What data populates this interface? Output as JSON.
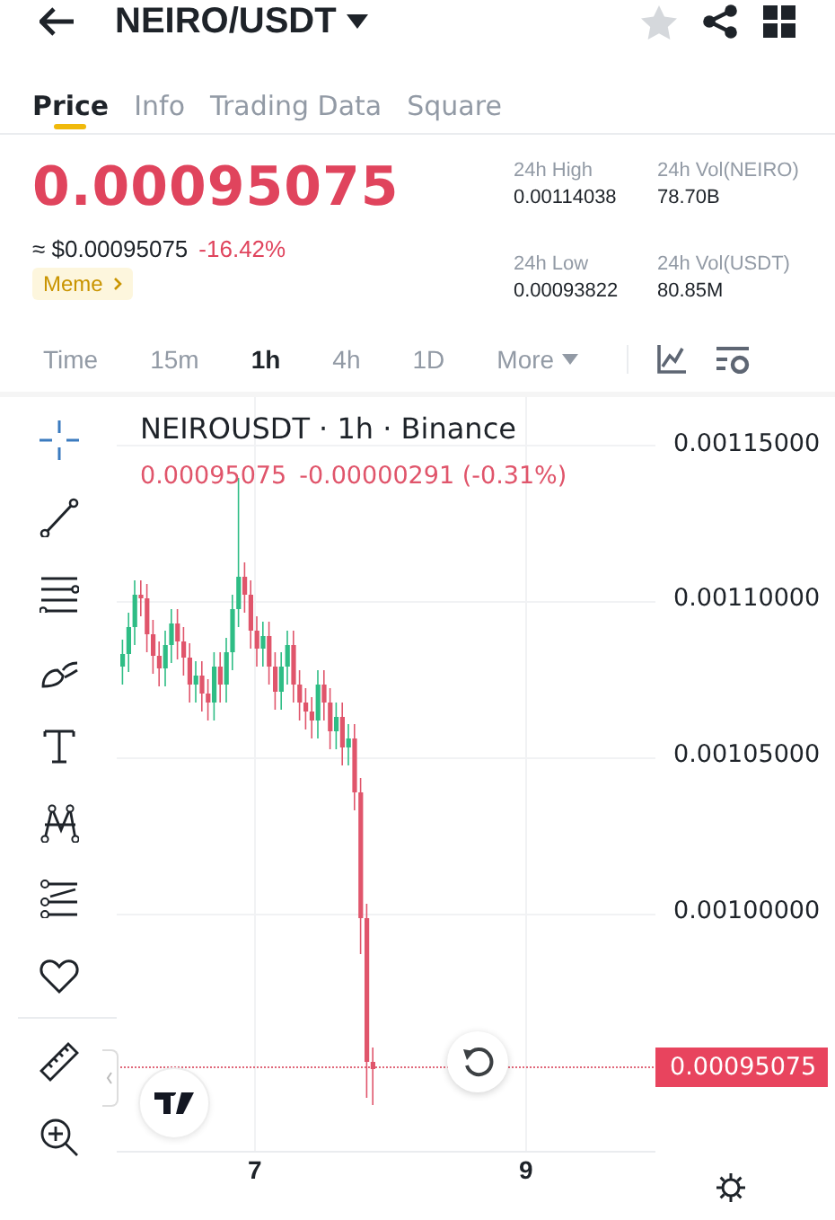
{
  "header": {
    "title": "NEIRO/USDT",
    "favorited": false
  },
  "tabs": [
    {
      "label": "Price",
      "selected": true
    },
    {
      "label": "Info",
      "selected": false
    },
    {
      "label": "Trading Data",
      "selected": false
    },
    {
      "label": "Square",
      "selected": false
    }
  ],
  "ticker": {
    "price": "0.00095075",
    "fiat": "≈ $0.00095075",
    "change": "-16.42%",
    "tag": "Meme"
  },
  "stats": [
    {
      "label": "24h High",
      "value": "0.00114038"
    },
    {
      "label": "24h Vol(NEIRO)",
      "value": "78.70B"
    },
    {
      "label": "24h Low",
      "value": "0.00093822"
    },
    {
      "label": "24h Vol(USDT)",
      "value": "80.85M"
    }
  ],
  "intervals": [
    {
      "label": "Time",
      "selected": false,
      "kind": "plain"
    },
    {
      "label": "15m",
      "selected": false,
      "kind": "plain"
    },
    {
      "label": "1h",
      "selected": true,
      "kind": "plain"
    },
    {
      "label": "4h",
      "selected": false,
      "kind": "plain"
    },
    {
      "label": "1D",
      "selected": false,
      "kind": "plain"
    },
    {
      "label": "More",
      "selected": false,
      "kind": "dropdown"
    }
  ],
  "tools": [
    {
      "kind": "crosshair",
      "selected": true
    },
    {
      "kind": "trendline",
      "selected": false
    },
    {
      "kind": "lines",
      "selected": false
    },
    {
      "kind": "brush",
      "selected": false
    },
    {
      "kind": "text",
      "selected": false
    },
    {
      "kind": "pattern",
      "selected": false
    },
    {
      "kind": "forecast",
      "selected": false
    },
    {
      "kind": "heart",
      "selected": false
    },
    {
      "kind": "ruler",
      "selected": false
    },
    {
      "kind": "zoom",
      "selected": false
    }
  ],
  "chart": {
    "legend": "NEIROUSDT · 1h · Binance",
    "last": "0.00095075",
    "delta": "-0.00000291 (-0.31%)",
    "price_axis": [
      "0.00115000",
      "0.00110000",
      "0.00105000",
      "0.00100000"
    ],
    "current_price": "0.00095075",
    "time_axis": [
      "7",
      "9"
    ]
  }
}
